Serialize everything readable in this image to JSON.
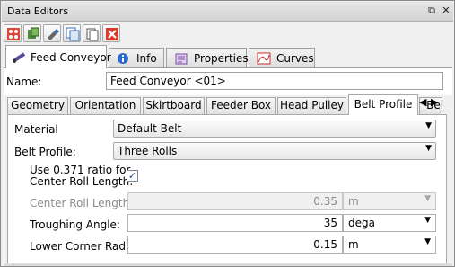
{
  "window": {
    "title": "Data Editors",
    "restore_icon": "⧉",
    "close_icon": "✕"
  },
  "toolbar": {
    "buttons": [
      "add-object",
      "copy-object",
      "paint-object",
      "duplicate-object",
      "copy-page",
      "delete"
    ]
  },
  "top_tabs": [
    {
      "label": "Feed Conveyor",
      "icon": "conveyor-icon"
    },
    {
      "label": "Info",
      "icon": "info-icon"
    },
    {
      "label": "Properties",
      "icon": "properties-icon"
    },
    {
      "label": "Curves",
      "icon": "curves-icon"
    }
  ],
  "name_field": {
    "label": "Name:",
    "value": "Feed Conveyor <01>"
  },
  "sub_tabs": [
    "Geometry",
    "Orientation",
    "Skirtboard",
    "Feeder Box",
    "Head Pulley",
    "Belt Profile",
    "Belt"
  ],
  "form": {
    "material": {
      "label": "Material",
      "value": "Default Belt"
    },
    "belt_profile": {
      "label": "Belt Profile:",
      "value": "Three Rolls"
    },
    "ratio": {
      "label_line1": "Use 0.371 ratio for",
      "label_line2": "Center Roll Length:",
      "checked_mark": "✓"
    },
    "center_roll": {
      "label": "Center Roll Length:",
      "value": "0.35",
      "unit": "m"
    },
    "troughing": {
      "label": "Troughing Angle:",
      "value": "35",
      "unit": "dega"
    },
    "lower_corner": {
      "label": "Lower Corner Radius:",
      "value": "0.15",
      "unit": "m"
    }
  },
  "colors": {
    "accent": "#2a4a8a",
    "delete_red": "#d83a2e"
  }
}
